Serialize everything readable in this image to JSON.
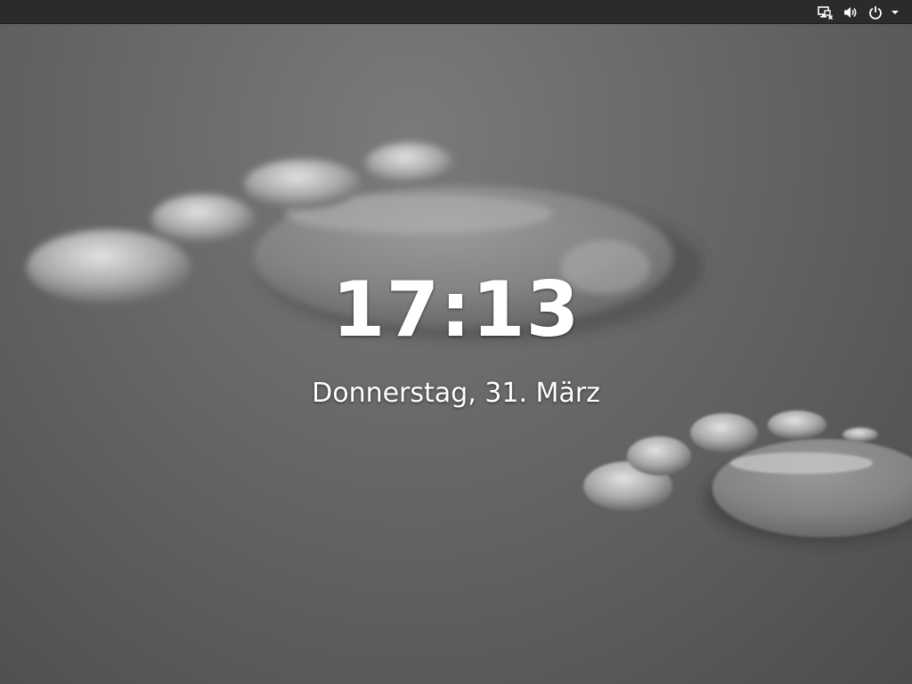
{
  "lock_screen": {
    "time": "17:13",
    "date": "Donnerstag, 31. März"
  },
  "topbar": {
    "status_icons": [
      {
        "name": "network-wired-disconnected-icon"
      },
      {
        "name": "volume-icon"
      },
      {
        "name": "power-icon"
      },
      {
        "name": "menu-arrow-down-icon"
      }
    ]
  },
  "wallpaper": {
    "subject": "water droplets in the shape of footprints",
    "colors": {
      "base": "#5a5a5a",
      "highlight": "#d0d0d0",
      "topbar": "#2b2b2b"
    }
  }
}
